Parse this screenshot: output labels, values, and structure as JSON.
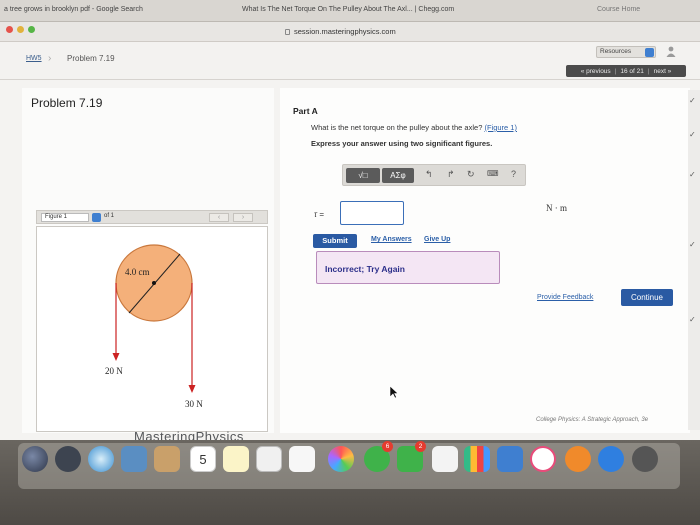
{
  "browser": {
    "tabs": [
      "a tree grows in brooklyn pdf - Google Search",
      "What Is The Net Torque On The Pulley About The Axl... | Chegg.com",
      "Course Home"
    ],
    "url": "session.masteringphysics.com"
  },
  "header": {
    "breadcrumb_hw": "HW5",
    "breadcrumb_problem": "Problem 7.19",
    "resources_label": "Resources",
    "nav_previous": "« previous",
    "nav_position": "16 of 21",
    "nav_next": "next »"
  },
  "left": {
    "problem_title": "Problem 7.19",
    "figure_label": "Figure 1",
    "figure_of": "of 1",
    "figure": {
      "radius_label": "4.0 cm",
      "force_left": "20 N",
      "force_right": "30 N"
    }
  },
  "right": {
    "part_label": "Part A",
    "question_text": "What is the net torque on the pulley about the axle?",
    "question_link": "(Figure 1)",
    "instruction": "Express your answer using two significant figures.",
    "toolbar": {
      "sqrt_label": "√□",
      "greek_label": "ΑΣφ",
      "help_label": "?"
    },
    "answer_symbol": "τ =",
    "answer_value": "",
    "unit": "N · m",
    "submit_label": "Submit",
    "my_answers_label": "My Answers",
    "give_up_label": "Give Up",
    "feedback_text": "Incorrect; Try Again",
    "provide_feedback_label": "Provide Feedback",
    "continue_label": "Continue"
  },
  "footer": {
    "brand": "MasteringPhysics",
    "book_ad": "College Physics: A Strategic Approach, 3e"
  },
  "dock": {
    "calendar_day": "5",
    "badges": [
      "6",
      "2"
    ]
  }
}
